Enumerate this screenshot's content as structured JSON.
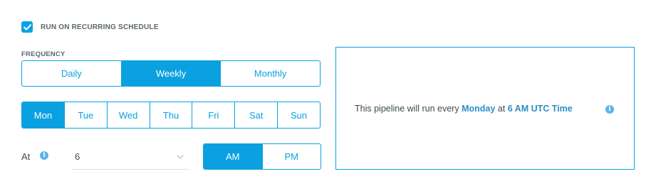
{
  "schedule": {
    "checkbox_label": "RUN ON RECURRING SCHEDULE",
    "checked": true
  },
  "frequency": {
    "label": "FREQUENCY",
    "options": [
      "Daily",
      "Weekly",
      "Monthly"
    ],
    "selected": "Weekly"
  },
  "days": {
    "options": [
      "Mon",
      "Tue",
      "Wed",
      "Thu",
      "Fri",
      "Sat",
      "Sun"
    ],
    "selected": "Mon"
  },
  "time": {
    "at_label": "At",
    "hour_value": "6",
    "ampm_options": [
      "AM",
      "PM"
    ],
    "ampm_selected": "AM"
  },
  "summary": {
    "prefix": "This pipeline will run every",
    "day": "Monday",
    "middle": "at",
    "time": "6 AM UTC Time"
  },
  "icons": {
    "checkbox": "checkmark-icon",
    "at_info": "info-icon",
    "summary_info": "info-icon",
    "hour_dropdown": "chevron-down-icon"
  },
  "colors": {
    "accent": "#0ba1e0",
    "text": "#3d4a52",
    "emphasis": "#2a8fc7"
  }
}
